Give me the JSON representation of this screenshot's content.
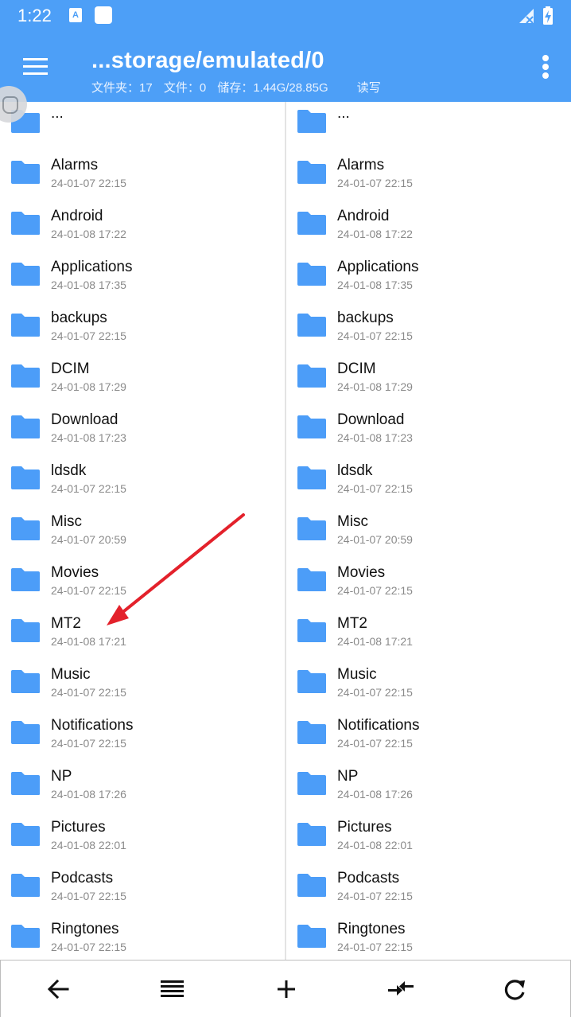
{
  "status_bar": {
    "time": "1:22",
    "notif_letter": "A",
    "icons": [
      "a-notification-icon",
      "square-notification-icon",
      "signal-icon",
      "battery-icon"
    ]
  },
  "app_bar": {
    "path": "...storage/emulated/0",
    "folders_label": "文件夹：17",
    "files_label": "文件：0",
    "storage_label": "储存：1.44G/28.85G",
    "mode_label": "读写"
  },
  "accent_color": "#4d9ff7",
  "folder_color": "#4c9df8",
  "left_pane": {
    "parent_label": "...",
    "items": [
      {
        "name": "Alarms",
        "date": "24-01-07 22:15"
      },
      {
        "name": "Android",
        "date": "24-01-08 17:22"
      },
      {
        "name": "Applications",
        "date": "24-01-08 17:35"
      },
      {
        "name": "backups",
        "date": "24-01-07 22:15"
      },
      {
        "name": "DCIM",
        "date": "24-01-08 17:29"
      },
      {
        "name": "Download",
        "date": "24-01-08 17:23"
      },
      {
        "name": "ldsdk",
        "date": "24-01-07 22:15"
      },
      {
        "name": "Misc",
        "date": "24-01-07 20:59"
      },
      {
        "name": "Movies",
        "date": "24-01-07 22:15"
      },
      {
        "name": "MT2",
        "date": "24-01-08 17:21"
      },
      {
        "name": "Music",
        "date": "24-01-07 22:15"
      },
      {
        "name": "Notifications",
        "date": "24-01-07 22:15"
      },
      {
        "name": "NP",
        "date": "24-01-08 17:26"
      },
      {
        "name": "Pictures",
        "date": "24-01-08 22:01"
      },
      {
        "name": "Podcasts",
        "date": "24-01-07 22:15"
      },
      {
        "name": "Ringtones",
        "date": "24-01-07 22:15"
      }
    ]
  },
  "right_pane": {
    "parent_label": "...",
    "items": [
      {
        "name": "Alarms",
        "date": "24-01-07 22:15"
      },
      {
        "name": "Android",
        "date": "24-01-08 17:22"
      },
      {
        "name": "Applications",
        "date": "24-01-08 17:35"
      },
      {
        "name": "backups",
        "date": "24-01-07 22:15"
      },
      {
        "name": "DCIM",
        "date": "24-01-08 17:29"
      },
      {
        "name": "Download",
        "date": "24-01-08 17:23"
      },
      {
        "name": "ldsdk",
        "date": "24-01-07 22:15"
      },
      {
        "name": "Misc",
        "date": "24-01-07 20:59"
      },
      {
        "name": "Movies",
        "date": "24-01-07 22:15"
      },
      {
        "name": "MT2",
        "date": "24-01-08 17:21"
      },
      {
        "name": "Music",
        "date": "24-01-07 22:15"
      },
      {
        "name": "Notifications",
        "date": "24-01-07 22:15"
      },
      {
        "name": "NP",
        "date": "24-01-08 17:26"
      },
      {
        "name": "Pictures",
        "date": "24-01-08 22:01"
      },
      {
        "name": "Podcasts",
        "date": "24-01-07 22:15"
      },
      {
        "name": "Ringtones",
        "date": "24-01-07 22:15"
      }
    ]
  },
  "toolbar": {
    "buttons": [
      "back-arrow-icon",
      "list-menu-icon",
      "plus-icon",
      "swap-panes-icon",
      "refresh-icon"
    ]
  }
}
